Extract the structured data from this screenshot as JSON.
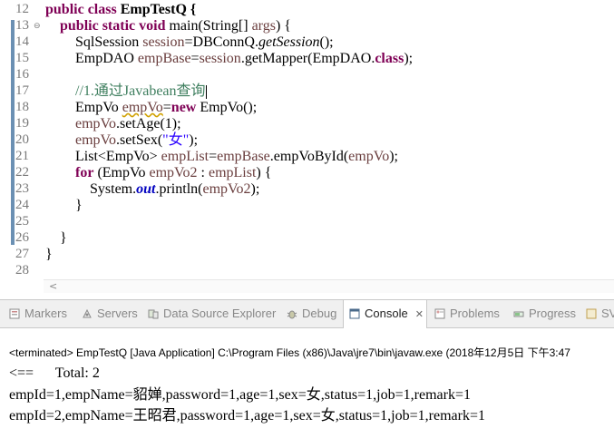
{
  "editor": {
    "line_numbers": [
      "12",
      "13",
      "14",
      "15",
      "16",
      "17",
      "18",
      "19",
      "20",
      "21",
      "22",
      "23",
      "24",
      "25",
      "26",
      "27",
      "28"
    ],
    "lines": {
      "l12": {
        "kw": "public class",
        "rest": " EmpTestQ {"
      },
      "l13": {
        "kw": "public static void",
        "rest": " main(String[] ",
        "var": "args",
        "end": ") {"
      },
      "l14": {
        "a": "SqlSession ",
        "var": "session",
        "b": "=DBConnQ.",
        "it": "getSession",
        "c": "();"
      },
      "l15": {
        "a": "EmpDAO ",
        "var": "empBase",
        "b": "=",
        "var2": "session",
        "c": ".getMapper(EmpDAO.",
        "kw": "class",
        "d": ");"
      },
      "l17": {
        "comment": "//1.通过Javabean查询"
      },
      "l18": {
        "a": "EmpVo ",
        "var": "empVo",
        "b": "=",
        "kw": "new",
        "c": " EmpVo();"
      },
      "l19": {
        "var": "empVo",
        "a": ".setAge(1);"
      },
      "l20": {
        "var": "empVo",
        "a": ".setSex(",
        "str": "\"女\"",
        "b": ");"
      },
      "l21": {
        "a": "List<EmpVo> ",
        "var": "empList",
        "b": "=",
        "var2": "empBase",
        "c": ".empVoById(",
        "var3": "empVo",
        "d": ");"
      },
      "l22": {
        "kw": "for",
        "a": " (EmpVo ",
        "var": "empVo2",
        "b": " : ",
        "var2": "empList",
        "c": ") {"
      },
      "l23": {
        "a": "System.",
        "fld": "out",
        "b": ".println(",
        "var": "empVo2",
        "c": ");"
      },
      "l24": {
        "a": "}"
      },
      "l26": {
        "a": "}"
      },
      "l27": {
        "a": "}"
      }
    }
  },
  "tabs": [
    {
      "label": "Markers",
      "icon": "markers-icon"
    },
    {
      "label": "Servers",
      "icon": "servers-icon"
    },
    {
      "label": "Data Source Explorer",
      "icon": "data-source-icon"
    },
    {
      "label": "Debug",
      "icon": "debug-icon"
    },
    {
      "label": "Console",
      "icon": "console-icon",
      "active": true
    },
    {
      "label": "Problems",
      "icon": "problems-icon"
    },
    {
      "label": "Progress",
      "icon": "progress-icon"
    },
    {
      "label": "SV",
      "icon": "sv-icon"
    }
  ],
  "console": {
    "header": "<terminated> EmpTestQ [Java Application] C:\\Program Files (x86)\\Java\\jre7\\bin\\javaw.exe (2018年12月5日 下午3:47",
    "output": [
      "<==      Total: 2",
      "empId=1,empName=貂婵,password=1,age=1,sex=女,status=1,job=1,remark=1",
      "empId=2,empName=王昭君,password=1,age=1,sex=女,status=1,job=1,remark=1"
    ]
  },
  "colors": {
    "keyword": "#7f0055",
    "variable": "#6a3e3e",
    "comment": "#3f7f5f",
    "string": "#2a00ff",
    "field": "#0000c0"
  }
}
